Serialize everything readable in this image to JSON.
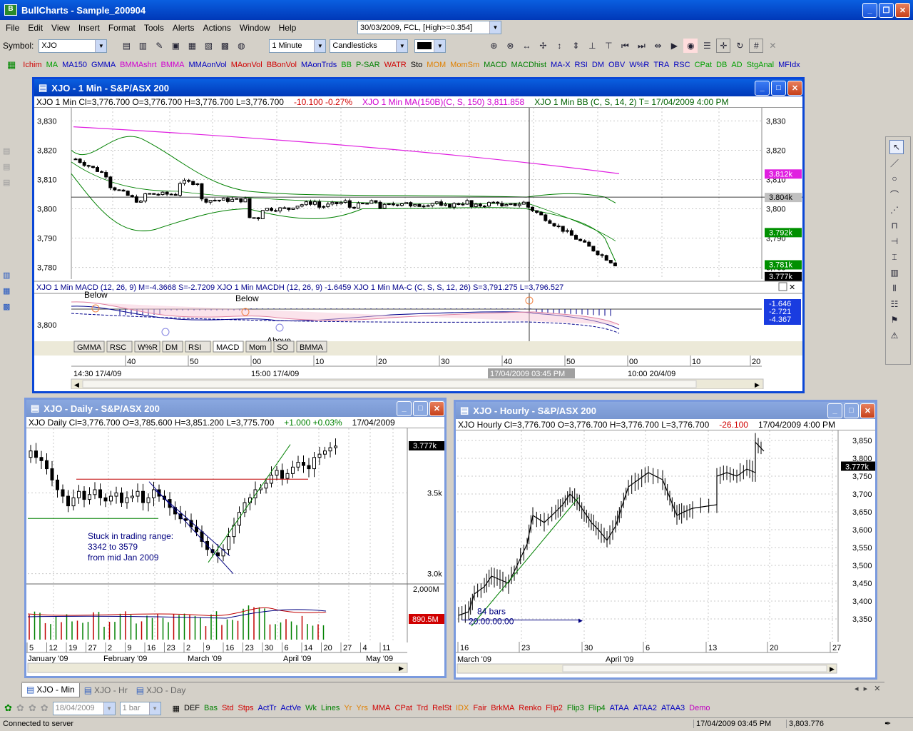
{
  "app": {
    "title": "BullCharts - Sample_200904"
  },
  "menu": [
    "File",
    "Edit",
    "View",
    "Insert",
    "Format",
    "Tools",
    "Alerts",
    "Actions",
    "Window",
    "Help"
  ],
  "toolbar": {
    "symbol_label": "Symbol:",
    "symbol": "XJO",
    "scan": "30/03/2009, FCL, [High>=0.354]",
    "interval": "1 Minute",
    "style": "Candlesticks"
  },
  "indicators": [
    {
      "t": "Ichim",
      "c": "#d00000"
    },
    {
      "t": "MA",
      "c": "#00a000"
    },
    {
      "t": "MA150",
      "c": "#0000c0"
    },
    {
      "t": "GMMA",
      "c": "#0000c0"
    },
    {
      "t": "BMMAshrt",
      "c": "#d000d0"
    },
    {
      "t": "BMMA",
      "c": "#d000d0"
    },
    {
      "t": "MMAonVol",
      "c": "#0000c0"
    },
    {
      "t": "MAonVol",
      "c": "#d00000"
    },
    {
      "t": "BBonVol",
      "c": "#d00000"
    },
    {
      "t": "MAonTrds",
      "c": "#0000c0"
    },
    {
      "t": "BB",
      "c": "#00a000"
    },
    {
      "t": "P-SAR",
      "c": "#008000"
    },
    {
      "t": "WATR",
      "c": "#d00000"
    },
    {
      "t": "Sto",
      "c": "#000000"
    },
    {
      "t": "MOM",
      "c": "#e08000"
    },
    {
      "t": "MomSm",
      "c": "#e08000"
    },
    {
      "t": "MACD",
      "c": "#008000"
    },
    {
      "t": "MACDhist",
      "c": "#008000"
    },
    {
      "t": "MA-X",
      "c": "#0000c0"
    },
    {
      "t": "RSI",
      "c": "#0000c0"
    },
    {
      "t": "DM",
      "c": "#0000c0"
    },
    {
      "t": "OBV",
      "c": "#0000c0"
    },
    {
      "t": "W%R",
      "c": "#0000c0"
    },
    {
      "t": "TRA",
      "c": "#0000c0"
    },
    {
      "t": "RSC",
      "c": "#0000c0"
    },
    {
      "t": "CPat",
      "c": "#00a000"
    },
    {
      "t": "DB",
      "c": "#00a000"
    },
    {
      "t": "AD",
      "c": "#00a000"
    },
    {
      "t": "StgAnal",
      "c": "#00a000"
    },
    {
      "t": "MFIdx",
      "c": "#0000c0"
    }
  ],
  "win1": {
    "title": "XJO - 1 Min - S&P/ASX 200",
    "head": [
      {
        "t": "XJO  1 Min   Cl=3,776.700  O=3,776.700  H=3,776.700  L=3,776.700",
        "c": "#000"
      },
      {
        "t": "-10.100  -0.27%",
        "c": "#d00000"
      },
      {
        "t": "XJO  1 Min MA(150B)(C, S, 150)  3,811.858",
        "c": "#d000d0"
      },
      {
        "t": "XJO  1 Min BB (C, S, 14, 2)  T=  17/04/2009 4:00 PM",
        "c": "#006000"
      }
    ],
    "yticks": [
      "3,830",
      "3,820",
      "3,810",
      "3,800",
      "3,790",
      "3,780"
    ],
    "badges": [
      {
        "t": "3.812k",
        "bg": "#e020e0"
      },
      {
        "t": "3.804k",
        "bg": "#c0c0c0"
      },
      {
        "t": "3.792k",
        "bg": "#009000"
      },
      {
        "t": "3.781k",
        "bg": "#009000"
      },
      {
        "t": "3.777k",
        "bg": "#000"
      }
    ],
    "macd_head": "XJO   1 Min  MACD (12, 26, 9)  M=-4.3668  S=-2.7209    XJO   1 Min  MACDH (12, 26, 9)  -1.6459     XJO   1 Min  MA-C (C, S, S, 12, 26)   S=3,791.275  L=3,796.527",
    "macd_ylabel": "3,800",
    "macd_zero": "0",
    "macd_badges": [
      "-1.646",
      "-2.721",
      "-4.367"
    ],
    "macd_notes": [
      "Below",
      "Below",
      "Above"
    ],
    "tabs": [
      "GMMA",
      "RSC",
      "W%R",
      "DM",
      "RSI",
      "MACD",
      "Mom",
      "SO",
      "BMMA"
    ],
    "xticks": [
      "40",
      "50",
      "00",
      "10",
      "20",
      "30",
      "40",
      "50",
      "00",
      "10",
      "20"
    ],
    "xdates": [
      "14:30 17/4/09",
      "15:00 17/4/09",
      "10:00 20/4/09"
    ],
    "cursor_date": "17/04/2009 03:45 PM"
  },
  "win2": {
    "title": "XJO - Daily - S&P/ASX 200",
    "head": [
      {
        "t": "XJO  Daily   Cl=3,776.700  O=3,785.600  H=3,851.200  L=3,775.700",
        "c": "#000"
      },
      {
        "t": "+1.000  +0.03%",
        "c": "#008000"
      },
      {
        "t": "17/04/2009",
        "c": "#000"
      }
    ],
    "yticks": [
      "3.5k",
      "3.0k"
    ],
    "badge": "3.777k",
    "vol_ticks": [
      "2,000M"
    ],
    "vol_badge": "890.5M",
    "note": [
      "Stuck in trading range:",
      "3342 to 3579",
      "from mid Jan 2009"
    ],
    "xticks": [
      "5",
      "12",
      "19",
      "27",
      "2",
      "9",
      "16",
      "23",
      "2",
      "9",
      "16",
      "23",
      "30",
      "6",
      "14",
      "20",
      "27",
      "4",
      "11"
    ],
    "months": [
      "January '09",
      "February '09",
      "March '09",
      "April '09",
      "May '09"
    ]
  },
  "win3": {
    "title": "XJO - Hourly - S&P/ASX 200",
    "head": [
      {
        "t": "XJO  Hourly   Cl=3,776.700  O=3,776.700  H=3,776.700  L=3,776.700",
        "c": "#000"
      },
      {
        "t": "-26.100",
        "c": "#d00000"
      },
      {
        "t": "17/04/2009 4:00 PM",
        "c": "#000"
      }
    ],
    "yticks": [
      "3,850",
      "3,800",
      "3,750",
      "3,700",
      "3,650",
      "3,600",
      "3,550",
      "3,500",
      "3,450",
      "3,400",
      "3,350"
    ],
    "badge": "3.777k",
    "note": [
      "84 bars",
      "20:00:00:00"
    ],
    "xticks": [
      "16",
      "23",
      "30",
      "6",
      "13",
      "20",
      "27"
    ],
    "months": [
      "March '09",
      "April '09"
    ]
  },
  "taskbar": [
    "XJO - Min",
    "XJO - Hr",
    "XJO - Day"
  ],
  "bottom": {
    "date": "18/04/2009",
    "interval": "1 bar",
    "scans": [
      {
        "t": "DEF",
        "c": "#000"
      },
      {
        "t": "Bas",
        "c": "#008000"
      },
      {
        "t": "Std",
        "c": "#d00000"
      },
      {
        "t": "Stps",
        "c": "#d00000"
      },
      {
        "t": "ActTr",
        "c": "#0000c0"
      },
      {
        "t": "ActVe",
        "c": "#0000c0"
      },
      {
        "t": "Wk",
        "c": "#008000"
      },
      {
        "t": "Lines",
        "c": "#008000"
      },
      {
        "t": "Yr",
        "c": "#e08000"
      },
      {
        "t": "Yrs",
        "c": "#e08000"
      },
      {
        "t": "MMA",
        "c": "#d00000"
      },
      {
        "t": "CPat",
        "c": "#d00000"
      },
      {
        "t": "Trd",
        "c": "#d00000"
      },
      {
        "t": "RelSt",
        "c": "#d00000"
      },
      {
        "t": "IDX",
        "c": "#e08000"
      },
      {
        "t": "Fair",
        "c": "#d00000"
      },
      {
        "t": "BrkMA",
        "c": "#d00000"
      },
      {
        "t": "Renko",
        "c": "#d00000"
      },
      {
        "t": "Flip2",
        "c": "#d00000"
      },
      {
        "t": "Flip3",
        "c": "#008000"
      },
      {
        "t": "Flip4",
        "c": "#008000"
      },
      {
        "t": "ATAA",
        "c": "#0000c0"
      },
      {
        "t": "ATAA2",
        "c": "#0000c0"
      },
      {
        "t": "ATAA3",
        "c": "#0000c0"
      },
      {
        "t": "Demo",
        "c": "#c000c0"
      }
    ]
  },
  "status": {
    "left": "Connected to server",
    "date": "17/04/2009 03:45 PM",
    "value": "3,803.776"
  }
}
